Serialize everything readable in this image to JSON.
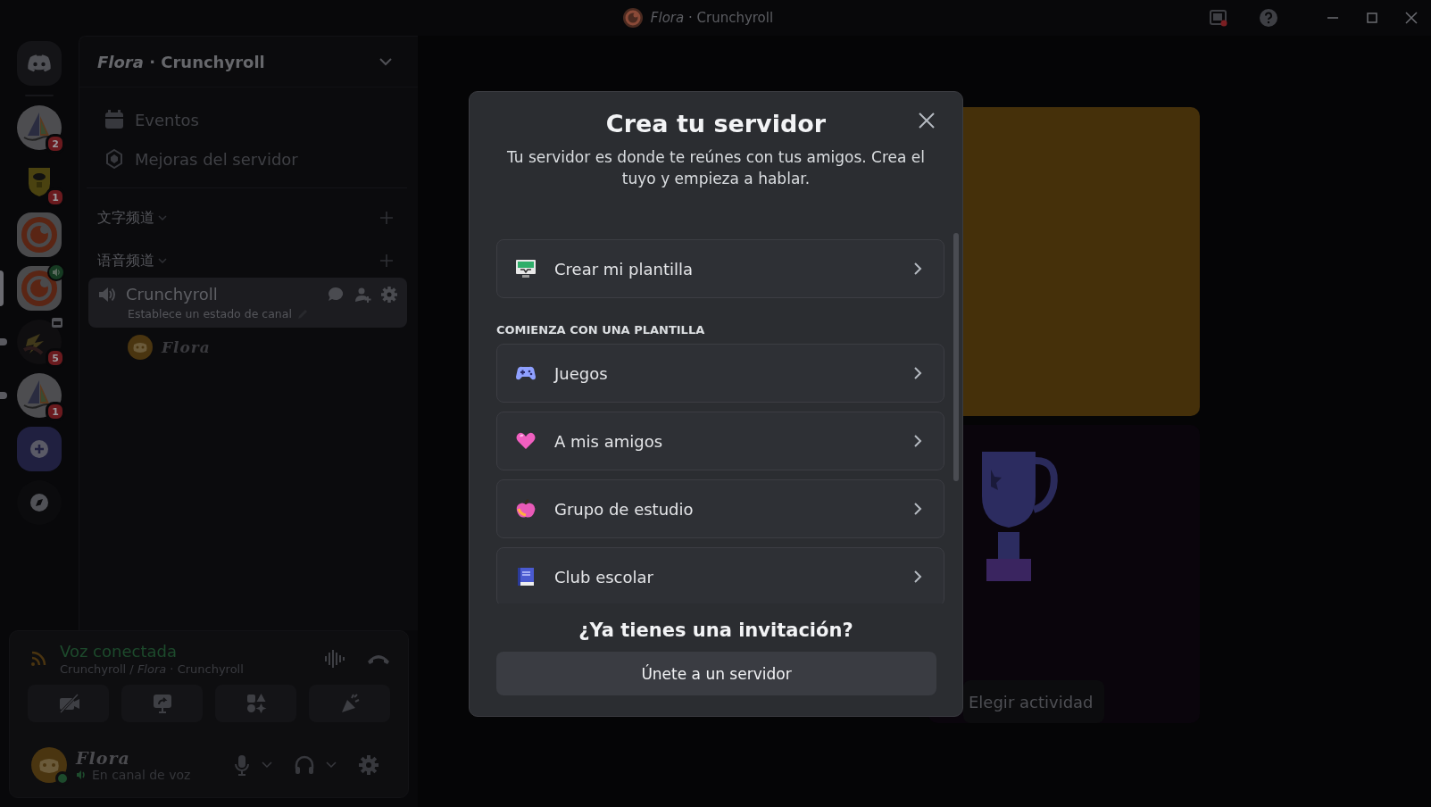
{
  "title_bar": {
    "title": "*Flora* · Crunchyroll"
  },
  "servers": [
    {
      "kind": "home",
      "selected": false,
      "unread": false,
      "voice": false,
      "event": false
    },
    {
      "kind": "boat",
      "badge": "2",
      "selected": false,
      "unread": false,
      "voice": false,
      "event": false
    },
    {
      "kind": "shield",
      "badge": "1",
      "selected": false,
      "unread": false,
      "voice": false,
      "event": false
    },
    {
      "kind": "crunchy",
      "selected": false,
      "unread": false,
      "voice": false,
      "event": false
    },
    {
      "kind": "crunchy",
      "selected": true,
      "unread": false,
      "voice": true,
      "event": false
    },
    {
      "kind": "dark",
      "badge": "5",
      "selected": false,
      "unread": true,
      "voice": false,
      "event": true
    },
    {
      "kind": "boat",
      "badge": "1",
      "selected": false,
      "unread": true,
      "voice": false,
      "event": false
    },
    {
      "kind": "add",
      "selected": false,
      "unread": false,
      "voice": false,
      "event": false
    },
    {
      "kind": "explore",
      "selected": false,
      "unread": false,
      "voice": false,
      "event": false
    }
  ],
  "sidebar": {
    "header": "*Flora* · Crunchyroll",
    "items": [
      {
        "label": "Eventos"
      },
      {
        "label": "Mejoras del servidor"
      }
    ],
    "categories": [
      {
        "name": "文字频道"
      },
      {
        "name": "语音频道",
        "channels": [
          {
            "name": "Crunchyroll",
            "status": "Establece un estado de canal",
            "selected": true,
            "members": [
              {
                "name": "Flora"
              }
            ]
          }
        ]
      }
    ]
  },
  "voice_panel": {
    "status": "Voz conectada",
    "location": "Crunchyroll / *Flora* · Crunchyroll"
  },
  "user": {
    "name": "Flora",
    "status": "En canal de voz"
  },
  "main": {
    "activity_button": "Elegir actividad"
  },
  "modal": {
    "title": "Crea tu servidor",
    "subtitle": "Tu servidor es donde te reúnes con tus amigos. Crea el tuyo y empieza a hablar.",
    "options": [
      {
        "label": "Crear mi plantilla"
      }
    ],
    "section": "COMIENZA CON UNA PLANTILLA",
    "templates": [
      {
        "label": "Juegos"
      },
      {
        "label": "A mis amigos"
      },
      {
        "label": "Grupo de estudio"
      },
      {
        "label": "Club escolar"
      }
    ],
    "footer_title": "¿Ya tienes una invitación?",
    "join_button": "Únete a un servidor"
  }
}
